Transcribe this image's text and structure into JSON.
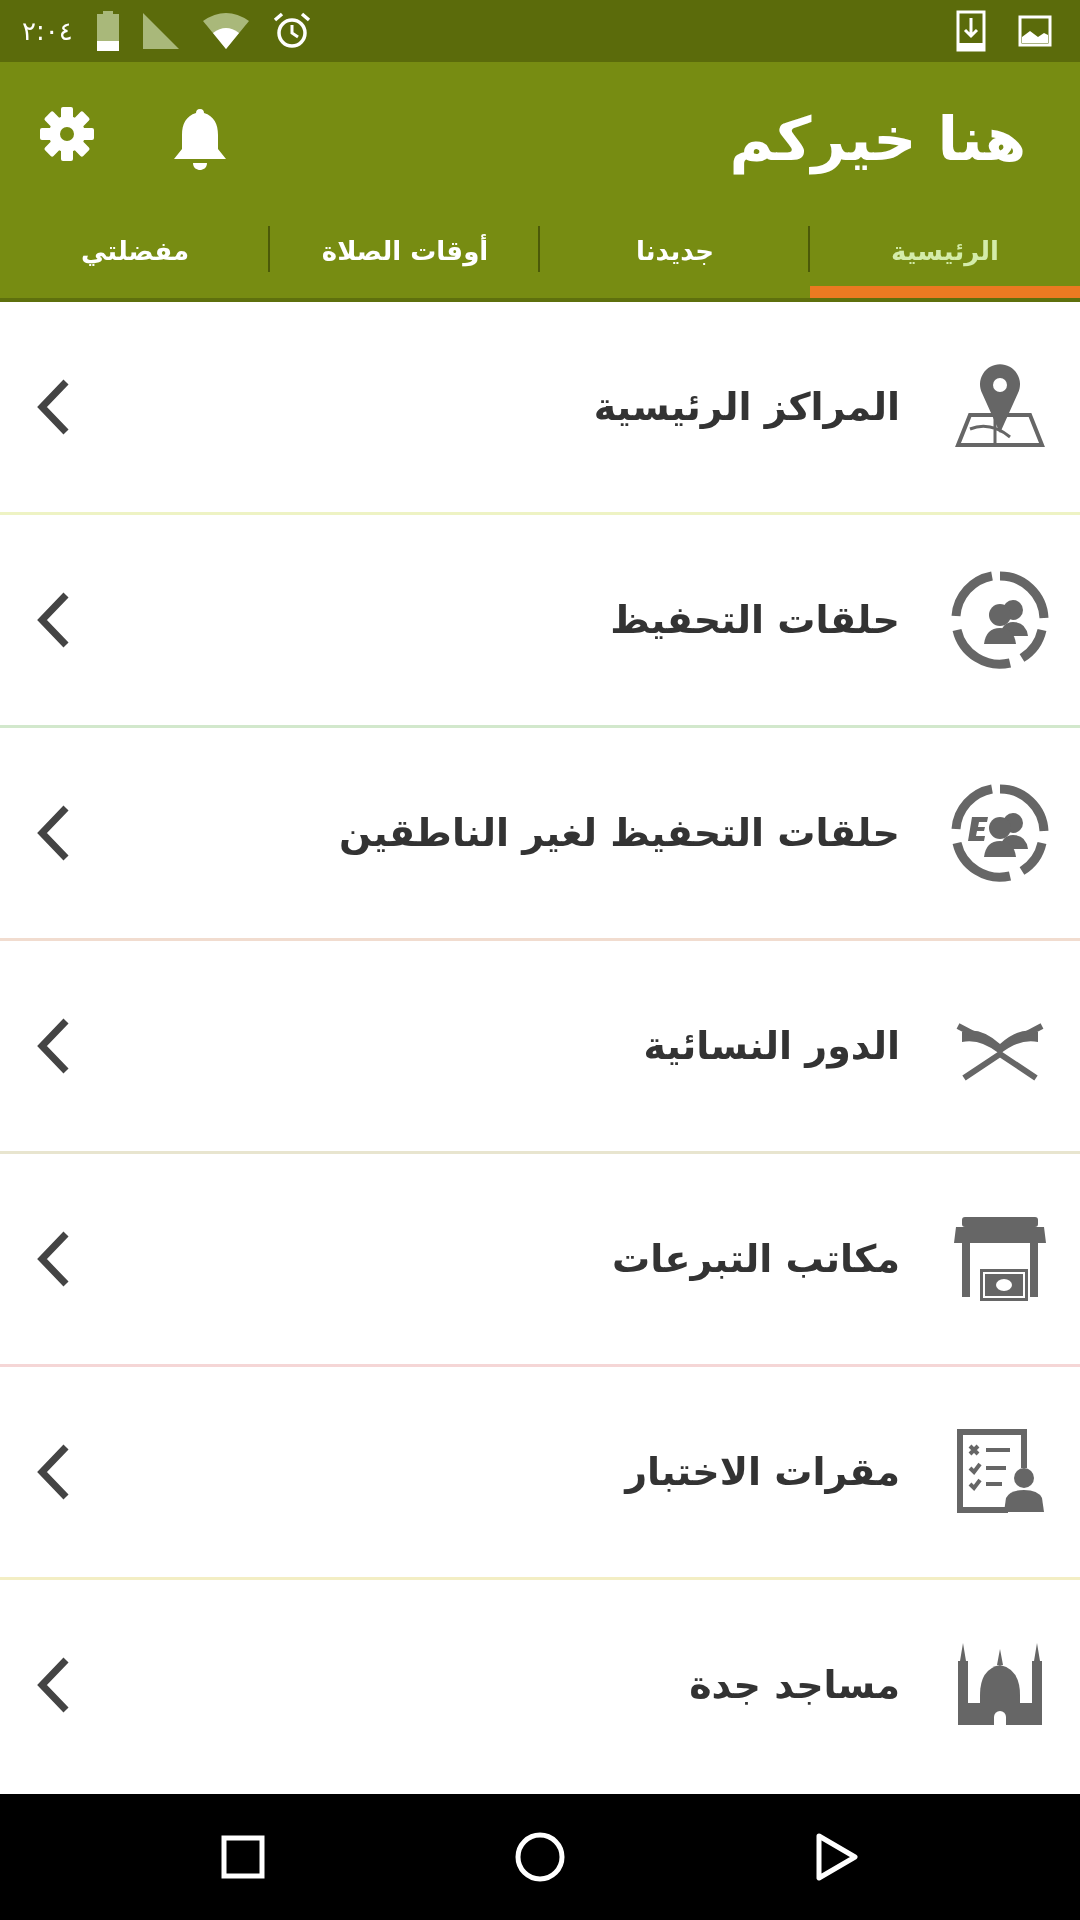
{
  "status_bar": {
    "time": "٢:٠٤"
  },
  "app_bar": {
    "title": "هنا خيركم"
  },
  "tabs": [
    {
      "label": "الرئيسية",
      "selected": true
    },
    {
      "label": "جديدنا",
      "selected": false
    },
    {
      "label": "أوقات الصلاة",
      "selected": false
    },
    {
      "label": "مفضلتي",
      "selected": false
    }
  ],
  "menu_items": [
    {
      "label": "المراكز الرئيسية",
      "color": "#eef3c4"
    },
    {
      "label": "حلقات التحفيظ",
      "color": "#d2e8cc"
    },
    {
      "label": "حلقات التحفيظ لغير الناطقين",
      "color": "#f1dccf"
    },
    {
      "label": "الدور النسائية",
      "color": "#e8e5cf"
    },
    {
      "label": "مكاتب التبرعات",
      "color": "#f5d6d6"
    },
    {
      "label": "مقرات الاختبار",
      "color": "#f3eec4"
    },
    {
      "label": "مساجد جدة"
    }
  ]
}
